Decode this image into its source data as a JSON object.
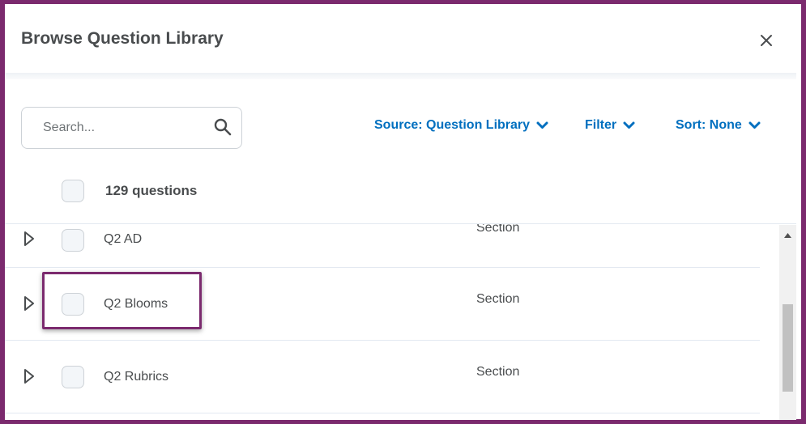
{
  "dialog": {
    "title": "Browse Question Library",
    "close_icon": "close-icon"
  },
  "toolbar": {
    "search": {
      "placeholder": "Search...",
      "value": "",
      "icon": "search-icon"
    },
    "source_label": "Source: Question Library",
    "filter_label": "Filter",
    "sort_label": "Sort: None",
    "dropdown_icon": "chevron-down-icon"
  },
  "list": {
    "count_label": "129 questions",
    "rows": [
      {
        "title": "Q2 AD",
        "type": "Section"
      },
      {
        "title": "Q2 Blooms",
        "type": "Section"
      },
      {
        "title": "Q2 Rubrics",
        "type": "Section"
      }
    ]
  },
  "colors": {
    "link": "#006fbf",
    "frame": "#7b2a6e",
    "text": "#494c4e"
  }
}
